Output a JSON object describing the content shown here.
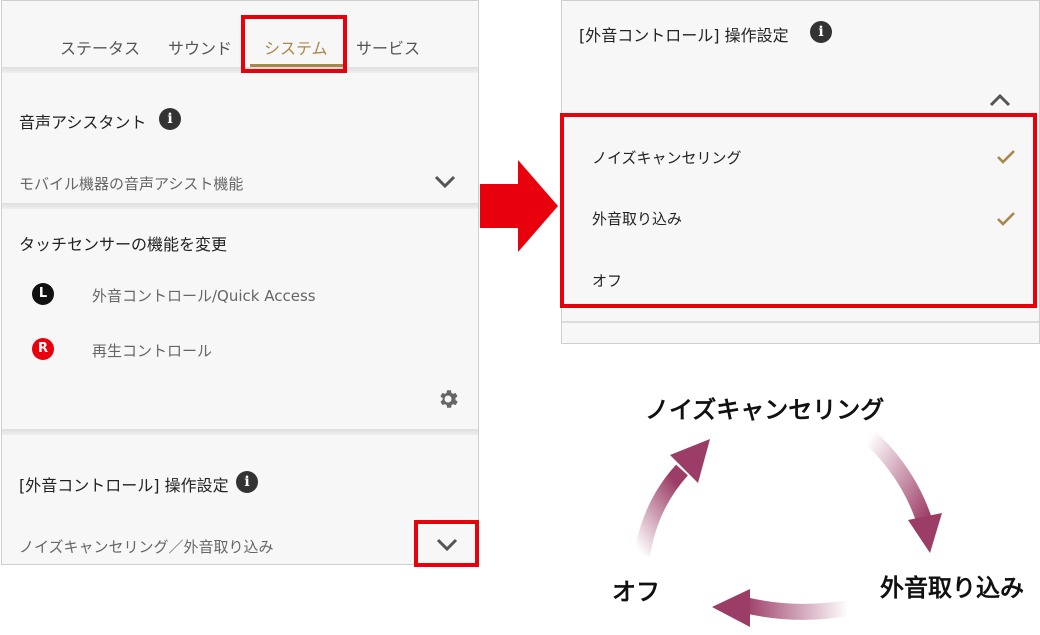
{
  "tabs": [
    {
      "label": "ステータス"
    },
    {
      "label": "サウンド"
    },
    {
      "label": "システム"
    },
    {
      "label": "サービス"
    }
  ],
  "voice_assistant": {
    "title": "音声アシスタント",
    "value": "モバイル機器の音声アシスト機能"
  },
  "touch_sensor": {
    "title": "タッチセンサーの機能を変更",
    "left_badge": "L",
    "left_label": "外音コントロール/Quick Access",
    "right_badge": "R",
    "right_label": "再生コントロール"
  },
  "ambient_control": {
    "title": "[外音コントロール] 操作設定",
    "value": "ノイズキャンセリング／外音取り込み"
  },
  "popup": {
    "title": "[外音コントロール] 操作設定",
    "options": [
      {
        "label": "ノイズキャンセリング",
        "checked": true
      },
      {
        "label": "外音取り込み",
        "checked": true
      },
      {
        "label": "オフ",
        "checked": false
      }
    ]
  },
  "cycle": {
    "top": "ノイズキャンセリング",
    "right": "外音取り込み",
    "left": "オフ"
  },
  "colors": {
    "accent": "#a9874a",
    "highlight": "#e8000c",
    "badge_l": "#111111",
    "badge_r": "#e8000c",
    "cycle_arrow": "#9c3d67"
  }
}
